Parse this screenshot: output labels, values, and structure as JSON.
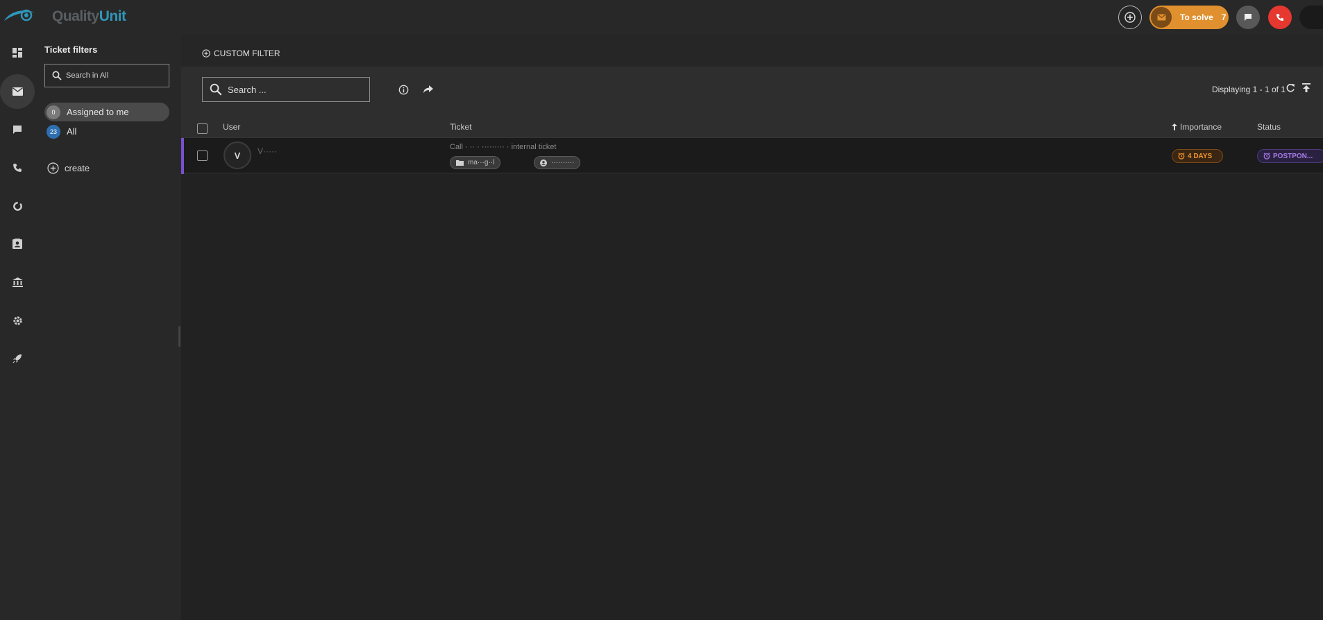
{
  "brand": {
    "name_part1": "Quality",
    "name_part2": "Unit"
  },
  "topbar": {
    "to_solve_label": "To solve",
    "to_solve_count": "7"
  },
  "nav": {
    "items": [
      "dashboard",
      "tickets",
      "chats",
      "calls",
      "reports",
      "contacts",
      "companies",
      "settings",
      "launch"
    ]
  },
  "filters": {
    "title": "Ticket filters",
    "search_placeholder": "Search in All",
    "items": [
      {
        "label": "Assigned to me",
        "count": "0",
        "badge_color": "#7a7a7a"
      },
      {
        "label": "All",
        "count": "23",
        "badge_color": "#2f6fb0"
      }
    ],
    "create_label": "create"
  },
  "main": {
    "custom_filter_label": "CUSTOM FILTER",
    "search_placeholder": "Search ...",
    "displaying": "Displaying 1 - 1 of 1",
    "columns": {
      "user": "User",
      "ticket": "Ticket",
      "importance": "Importance",
      "status": "Status"
    },
    "rows": [
      {
        "avatar_letter": "V",
        "user_name": "V·····",
        "subject": "Call · ·· · ········· · internal ticket",
        "tag1": "ma···g··l",
        "tag2": "··········",
        "importance": "4 DAYS",
        "status": "POSTPON..."
      }
    ]
  },
  "colors": {
    "accent_orange": "#e0902e",
    "call_red": "#e6382f",
    "brand_blue": "#2f95b8",
    "row_stripe": "#7b4fd0"
  }
}
